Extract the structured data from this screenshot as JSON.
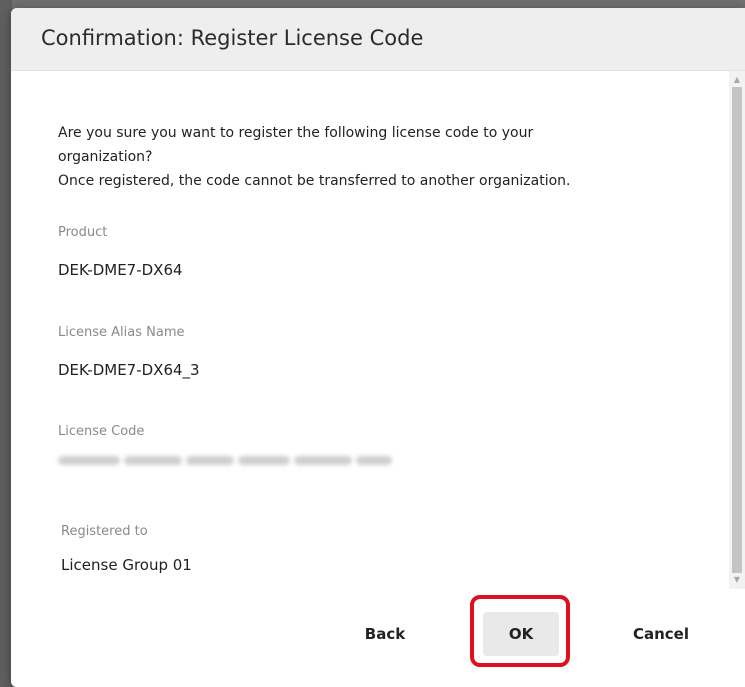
{
  "dialog": {
    "title": "Confirmation: Register License Code",
    "message_lines": [
      "Are you sure you want to register the following license code to your",
      "organization?",
      "Once registered, the code cannot be transferred to another organization."
    ],
    "fields": {
      "product": {
        "label": "Product",
        "value": "DEK-DME7-DX64"
      },
      "alias": {
        "label": "License Alias Name",
        "value": "DEK-DME7-DX64_3"
      },
      "code": {
        "label": "License Code"
      },
      "registered_to": {
        "label": "Registered to",
        "value": "License Group 01"
      }
    },
    "buttons": {
      "back": "Back",
      "ok": "OK",
      "cancel": "Cancel"
    }
  },
  "colors": {
    "highlight": "#e0101e",
    "header_bg": "#eeeeee",
    "ok_bg": "#e9e9e9",
    "label_text": "#8a8a8a"
  },
  "icons": {
    "scroll_up": "scroll-up-arrow-icon",
    "scroll_down": "scroll-down-arrow-icon"
  }
}
